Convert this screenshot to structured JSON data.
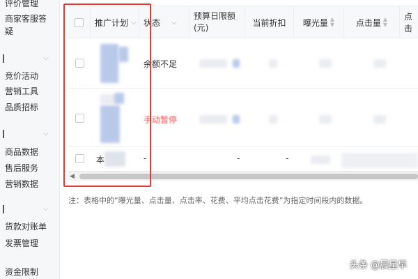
{
  "sidebar": {
    "items": [
      {
        "label": "评价管理"
      },
      {
        "label": "商家客服答"
      },
      {
        "label": "疑"
      },
      {
        "label": "竞价活动"
      },
      {
        "label": "营销工具"
      },
      {
        "label": "品质招标"
      },
      {
        "label": "商品数据"
      },
      {
        "label": "售后服务"
      },
      {
        "label": "营销数据"
      },
      {
        "label": "货款对账单"
      },
      {
        "label": "发票管理"
      },
      {
        "label": "资金限制"
      }
    ]
  },
  "table": {
    "columns": [
      {
        "label": "推广计划"
      },
      {
        "label": "状态"
      },
      {
        "label": "预算日限额(元)"
      },
      {
        "label": "当前折扣"
      },
      {
        "label": "曝光量"
      },
      {
        "label": "点击量"
      },
      {
        "label": "点击"
      }
    ],
    "rows": [
      {
        "status": "余额不足",
        "status_color": "#333333"
      },
      {
        "status": "手动暂停",
        "status_color": "#ee4d4d"
      },
      {
        "plan": "本 计",
        "status": "-",
        "budget": "-",
        "discount": "-"
      }
    ]
  },
  "note": "注：表格中的“曝光量、点击量、点击率、花费、平均点击花费”为指定时间段内的数据。",
  "watermark": "头条 @晨星早",
  "colors": {
    "highlight": "#e53935",
    "paused": "#ee4d4d"
  }
}
